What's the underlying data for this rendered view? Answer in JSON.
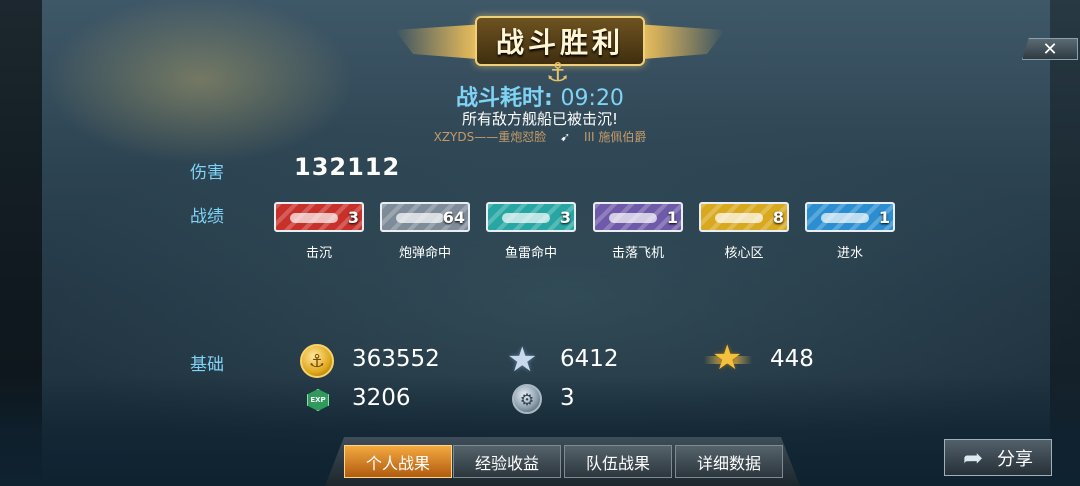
{
  "banner": {
    "title": "战斗胜利"
  },
  "close": {
    "glyph": "✕"
  },
  "battle": {
    "time_label": "战斗耗时:",
    "time_value": "09:20",
    "message": "所有敌方舰船已被击沉!",
    "kill_attacker": "XZYDS——重炮怼脸",
    "kill_target": "III  施佩伯爵"
  },
  "damage": {
    "label": "伤害",
    "value": "132112"
  },
  "achievements": {
    "label": "战绩",
    "items": [
      {
        "name": "击沉",
        "count": "3",
        "color": "#c8302a"
      },
      {
        "name": "炮弹命中",
        "count": "64",
        "color": "#7e8c99"
      },
      {
        "name": "鱼雷命中",
        "count": "3",
        "color": "#27a7a3"
      },
      {
        "name": "击落飞机",
        "count": "1",
        "color": "#6e5aa8"
      },
      {
        "name": "核心区",
        "count": "8",
        "color": "#d8a81e"
      },
      {
        "name": "进水",
        "count": "1",
        "color": "#2a8ed1"
      }
    ]
  },
  "base": {
    "label": "基础",
    "credits": "363552",
    "star_xp": "6412",
    "rank_points": "448",
    "exp": "3206",
    "exp_badge": "EXP",
    "gear": "3"
  },
  "tabs": [
    {
      "label": "个人战果",
      "active": true
    },
    {
      "label": "经验收益",
      "active": false
    },
    {
      "label": "队伍战果",
      "active": false
    },
    {
      "label": "详细数据",
      "active": false
    }
  ],
  "share": {
    "label": "分享"
  }
}
